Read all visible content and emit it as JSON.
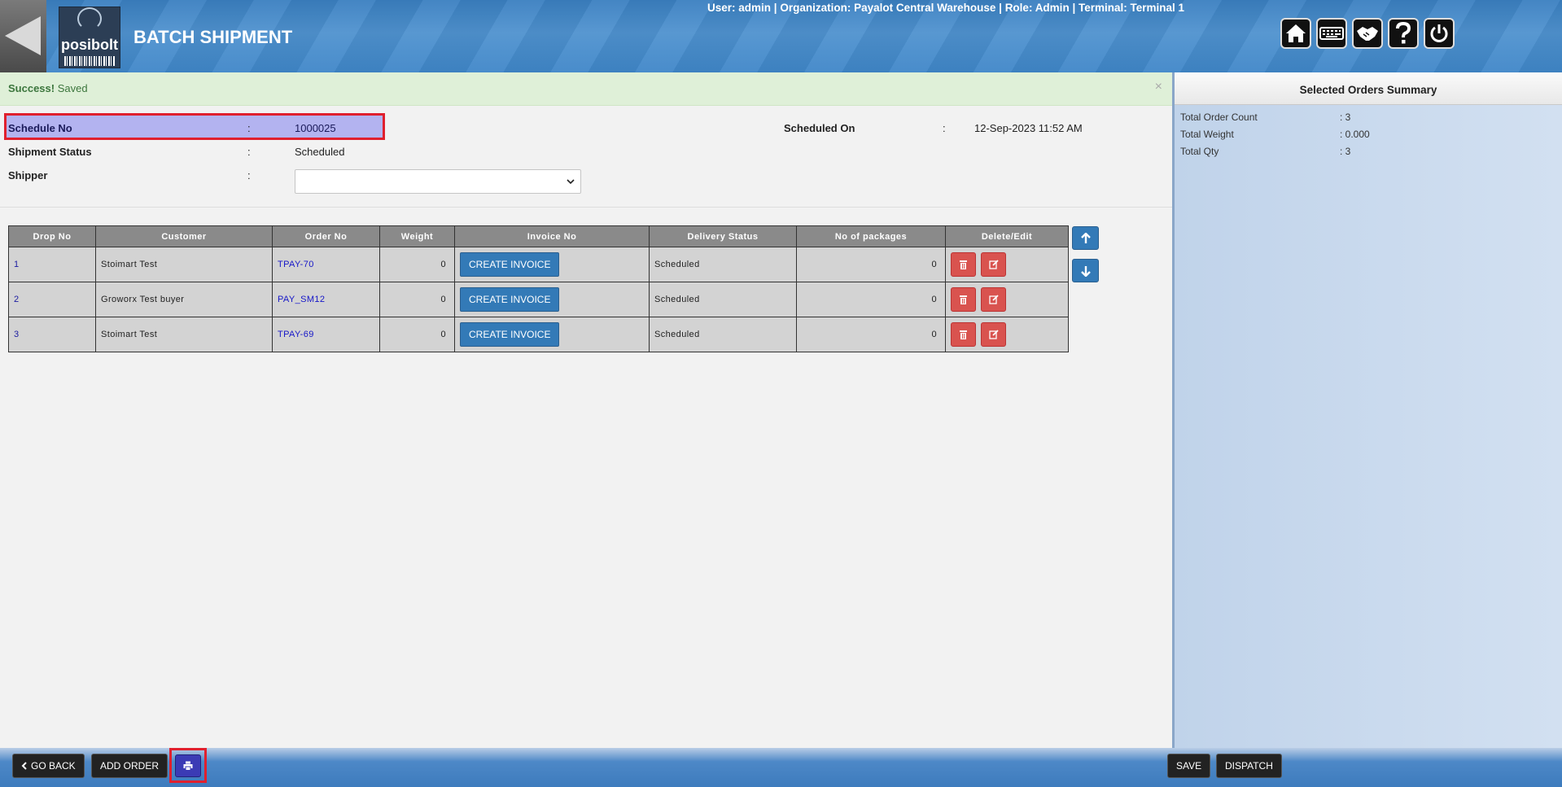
{
  "header": {
    "title": "BATCH SHIPMENT",
    "logo_text": "posibolt",
    "user_info": {
      "user_label": "User:",
      "user": "admin",
      "org_label": "Organization:",
      "org": "Payalot Central Warehouse",
      "role_label": "Role:",
      "role": "Admin",
      "terminal_label": "Terminal:",
      "terminal": "Terminal 1"
    },
    "icons": [
      "home-icon",
      "keyboard-icon",
      "handshake-icon",
      "help-icon",
      "power-icon"
    ]
  },
  "alert": {
    "strong": "Success!",
    "text": "Saved",
    "close": "×"
  },
  "form": {
    "schedule_no_label": "Schedule No",
    "schedule_no": "1000025",
    "status_label": "Shipment Status",
    "status": "Scheduled",
    "shipper_label": "Shipper",
    "shipper": "",
    "scheduled_on_label": "Scheduled On",
    "scheduled_on": "12-Sep-2023 11:52 AM",
    "colon": ":"
  },
  "table": {
    "headers": [
      "Drop No",
      "Customer",
      "Order No",
      "Weight",
      "Invoice No",
      "Delivery Status",
      "No of packages",
      "Delete/Edit"
    ],
    "rows": [
      {
        "drop": "1",
        "customer": "Stoimart Test",
        "order": "TPAY-70",
        "weight": "0",
        "invoice_btn": "CREATE INVOICE",
        "status": "Scheduled",
        "packages": "0"
      },
      {
        "drop": "2",
        "customer": "Groworx Test buyer",
        "order": "PAY_SM12",
        "weight": "0",
        "invoice_btn": "CREATE INVOICE",
        "status": "Scheduled",
        "packages": "0"
      },
      {
        "drop": "3",
        "customer": "Stoimart Test",
        "order": "TPAY-69",
        "weight": "0",
        "invoice_btn": "CREATE INVOICE",
        "status": "Scheduled",
        "packages": "0"
      }
    ]
  },
  "summary": {
    "title": "Selected Orders Summary",
    "items": [
      {
        "label": "Total Order Count",
        "value": ": 3"
      },
      {
        "label": "Total Weight",
        "value": ": 0.000"
      },
      {
        "label": "Total Qty",
        "value": ": 3"
      }
    ]
  },
  "footer": {
    "go_back": "GO BACK",
    "add_order": "ADD ORDER",
    "save": "SAVE",
    "dispatch": "DISPATCH"
  },
  "colors": {
    "header_blue": "#4f92cf",
    "primary_btn": "#337ab7",
    "danger_btn": "#d9534f",
    "highlight": "#e0202e",
    "success_bg": "#dff0d8"
  }
}
